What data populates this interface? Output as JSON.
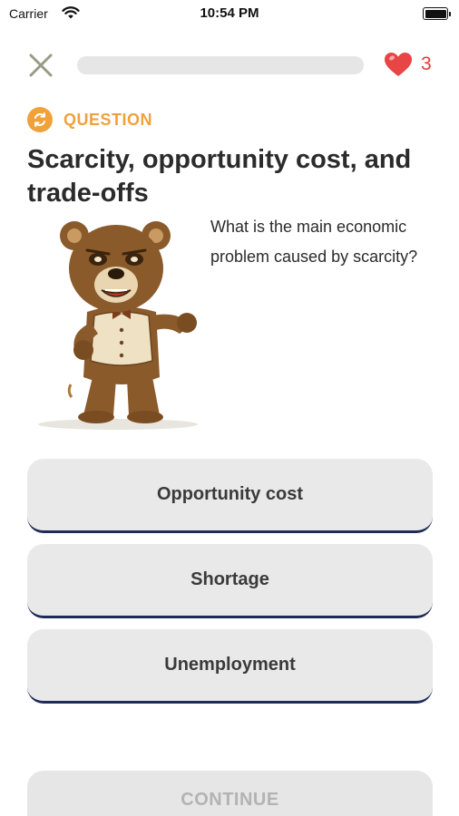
{
  "status_bar": {
    "carrier": "Carrier",
    "time": "10:54 PM"
  },
  "top_bar": {
    "progress": 0.0,
    "hearts_count": "3",
    "icons": [
      "close-icon",
      "heart-icon"
    ]
  },
  "question": {
    "label": "QUESTION",
    "icon": "refresh-icon",
    "title": "Scarcity, opportunity cost, and trade-offs",
    "prompt": "What is the main economic problem caused by scarcity?",
    "mascot": "bear-illustration"
  },
  "answers": [
    {
      "label": "Opportunity cost"
    },
    {
      "label": "Shortage"
    },
    {
      "label": "Unemployment"
    }
  ],
  "continue_button": {
    "label": "CONTINUE",
    "enabled": false
  },
  "colors": {
    "accent": "#f0a13a",
    "heart": "#e53a3a",
    "answer_bg": "#e9e9e9",
    "answer_border": "#1d2b55",
    "disabled_text": "#b3b3b3"
  }
}
